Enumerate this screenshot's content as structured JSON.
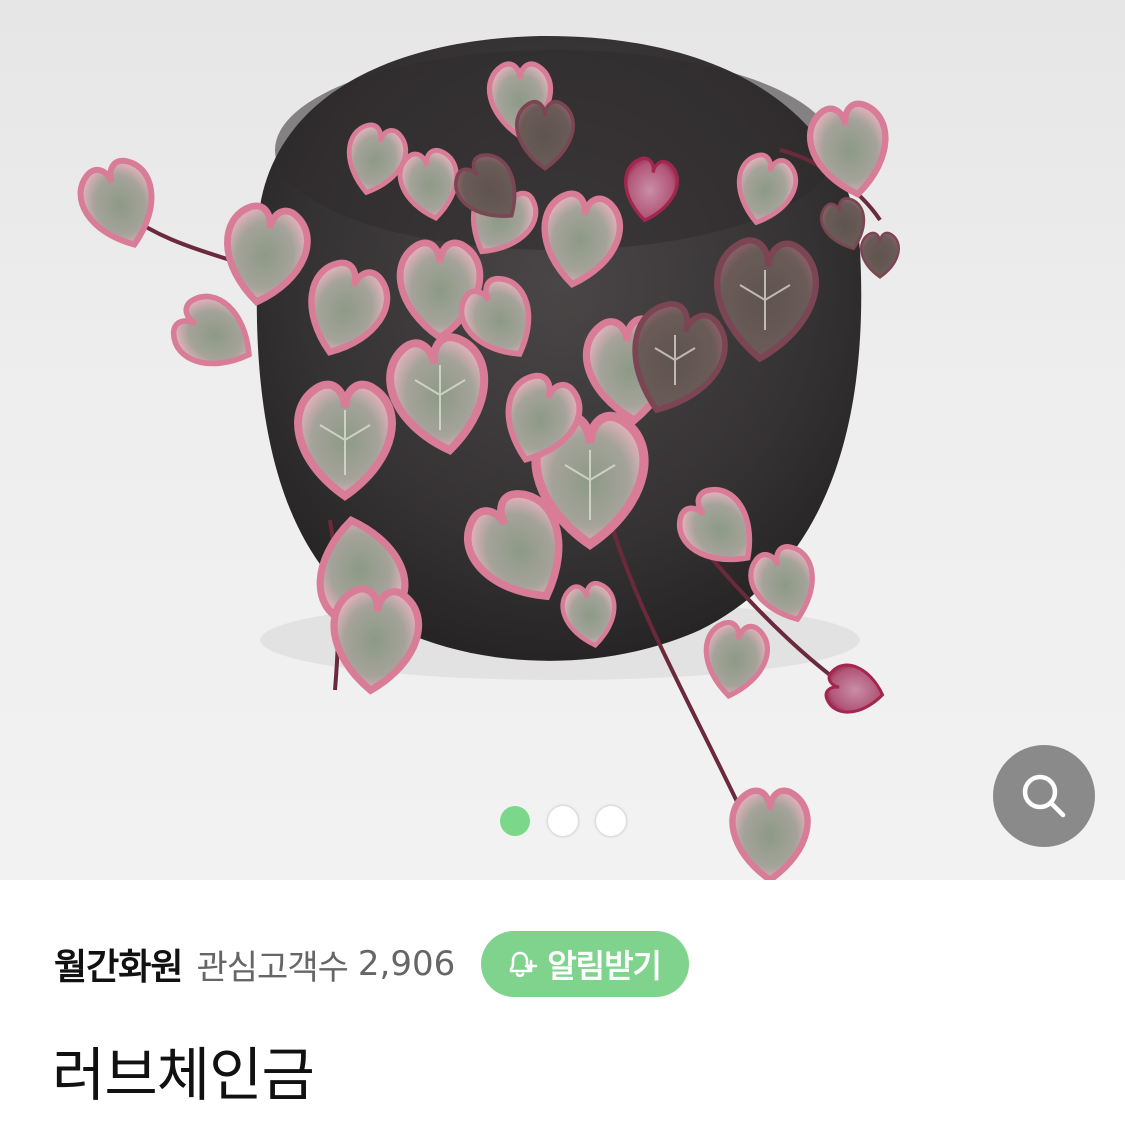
{
  "product_image": {
    "alt": "러브체인금"
  },
  "carousel": {
    "total": 3,
    "active_index": 0,
    "active_color": "#7bd88a"
  },
  "zoom": {
    "icon": "search-icon"
  },
  "store": {
    "name": "월간화원",
    "follower_label": "관심고객수",
    "follower_count": "2,906"
  },
  "notify": {
    "label": "알림받기",
    "icon": "bell-plus-icon",
    "color": "#7fd38c"
  },
  "product": {
    "title": "러브체인금"
  }
}
